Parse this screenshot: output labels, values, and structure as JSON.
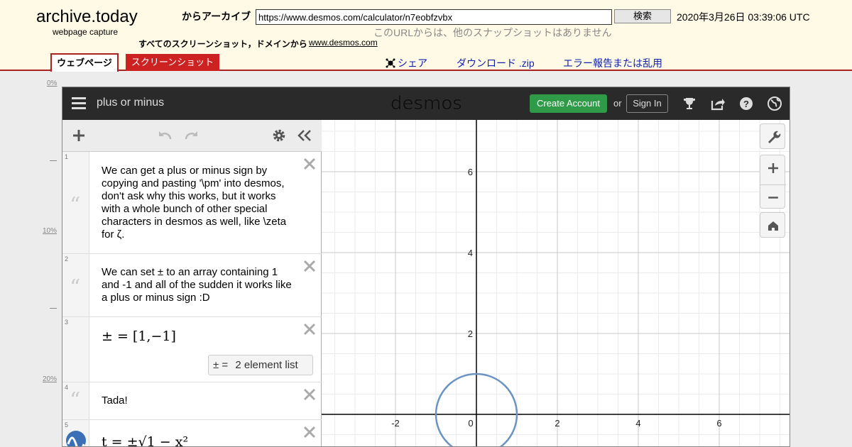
{
  "archive": {
    "logo": "archive.today",
    "subtitle": "webpage capture",
    "from_archive_label": "からアーカイブ",
    "url_value": "https://www.desmos.com/calculator/n7eobfzvbx",
    "search_label": "検索",
    "capture_date": "2020年3月26日 03:39:06 UTC",
    "no_other_snapshots": "このURLからは、他のスナップショットはありません",
    "all_screenshots_label": "すべてのスクリーンショット，ドメインから",
    "domain_link": "www.desmos.com",
    "tabs": {
      "webpage": "ウェブページ",
      "screenshot": "スクリーンショット"
    },
    "share_label": "シェア",
    "download_label": "ダウンロード .zip",
    "report_label": "エラー報告または乱用"
  },
  "ruler": {
    "p0": "0%",
    "p10": "10%",
    "p20": "20%"
  },
  "desmos": {
    "graph_title": "plus or minus",
    "logo": "desmos",
    "create_account": "Create Account",
    "or": "or",
    "sign_in": "Sign In",
    "accent_green": "#2f9a48",
    "curve_color": "#6b93c4",
    "expressions": [
      {
        "num": "1",
        "text": "We can get a plus or minus sign by copying and pasting '\\pm' into desmos, don't ask why this works, but it works with a whole bunch of other special characters in desmos as well, like \\zeta for ζ."
      },
      {
        "num": "2",
        "text": "We can set ± to an array containing 1 and -1 and all of the sudden it works like a plus or minus sign :D"
      },
      {
        "num": "3",
        "math": "± = [1,−1]",
        "badge_symbol": "±  =",
        "badge_text": "2 element list"
      },
      {
        "num": "4",
        "text": "Tada!"
      },
      {
        "num": "5",
        "math": "t = ±√1 − x²"
      }
    ],
    "graph": {
      "x_ticks": [
        "-2",
        "0",
        "2",
        "4",
        "6"
      ],
      "y_ticks": [
        "2",
        "4",
        "6"
      ]
    }
  }
}
